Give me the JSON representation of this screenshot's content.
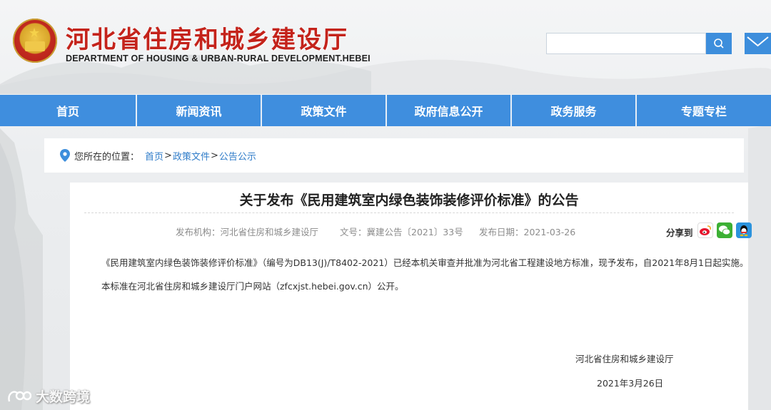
{
  "header": {
    "title_cn": "河北省住房和城乡建设厅",
    "title_en": "DEPARTMENT OF HOUSING & URBAN-RURAL DEVELOPMENT.HEBEI",
    "search_placeholder": ""
  },
  "nav": {
    "items": [
      "首页",
      "新闻资讯",
      "政策文件",
      "政府信息公开",
      "政务服务",
      "专题专栏"
    ]
  },
  "breadcrumb": {
    "prefix": "您所在的位置：",
    "links": [
      "首页",
      "政策文件",
      "公告公示"
    ],
    "separator": ">"
  },
  "article": {
    "title": "关于发布《民用建筑室内绿色装饰装修评价标准》的公告",
    "meta": {
      "publisher": "发布机构：河北省住房和城乡建设厅",
      "doc_no": "文号：冀建公告〔2021〕33号",
      "date": "发布日期：2021-03-26"
    },
    "share_label": "分享到",
    "paragraphs": [
      "《民用建筑室内绿色装饰装修评价标准》（编号为DB13(J)/T8402-2021）已经本机关审查并批准为河北省工程建设地方标准，现予发布，自2021年8月1日起实施。",
      "本标准在河北省住房和城乡建设厅门户网站（zfcxjst.hebei.gov.cn）公开。"
    ],
    "signature": "河北省住房和城乡建设厅",
    "signature_date": "2021年3月26日"
  },
  "watermark": "大数跨境",
  "colors": {
    "brand_red": "#c4231b",
    "nav_blue": "#3f8ede",
    "link_blue": "#2f7cc9"
  },
  "icons": [
    "emblem-icon",
    "search-icon",
    "mail-icon",
    "location-icon",
    "weibo-icon",
    "wechat-icon",
    "qq-icon"
  ]
}
